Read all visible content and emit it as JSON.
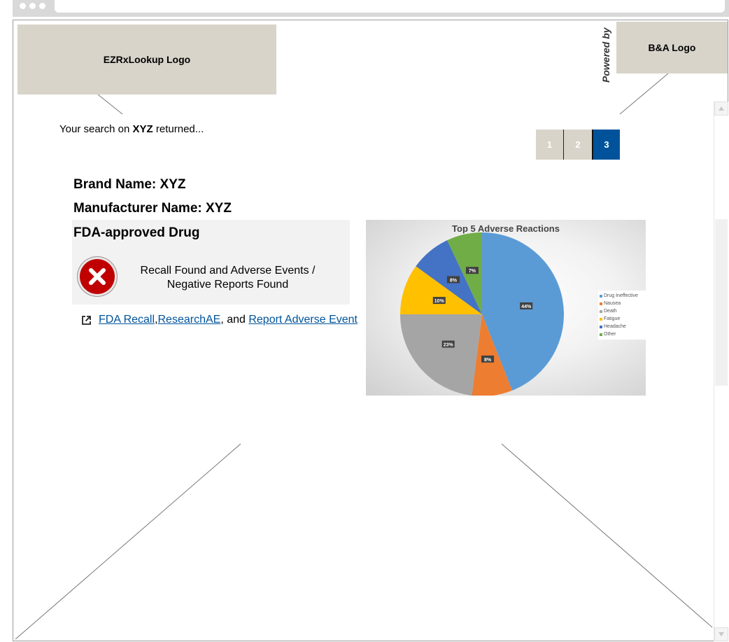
{
  "logos": {
    "ezrx": "EZRxLookup Logo",
    "ba": "B&A Logo",
    "powered_by": "Powered by"
  },
  "search": {
    "prefix": "Your search on ",
    "term": "XYZ",
    "suffix": " returned..."
  },
  "pagination": {
    "pages": [
      "1",
      "2",
      "3"
    ],
    "active": "3"
  },
  "drug": {
    "brand": "Brand Name: XYZ",
    "manufacturer": "Manufacturer Name: XYZ",
    "status_title": "FDA-approved Drug",
    "status_line1": "Recall Found and Adverse Events /",
    "status_line2": "Negative Reports Found",
    "status_icon": "error-x-icon",
    "status_color": "#c00000"
  },
  "links": {
    "icon": "external-link-icon",
    "fda_recall": "FDA Recall",
    "sep1": ", ",
    "research_ae": "ResearchAE",
    "sep2": ", and ",
    "report_event": "Report Adverse Event"
  },
  "chart_data": {
    "type": "pie",
    "title": "Top 5 Adverse Reactions",
    "categories": [
      "Drug Ineffective",
      "Nausea",
      "Death",
      "Fatigue",
      "Headache",
      "Other"
    ],
    "values": [
      44,
      8,
      23,
      10,
      8,
      7
    ],
    "labels": [
      "44%",
      "8%",
      "23%",
      "10%",
      "8%",
      "7%"
    ],
    "colors": [
      "#5b9bd5",
      "#ed7d31",
      "#a5a5a5",
      "#ffc000",
      "#4472c4",
      "#70ad47"
    ],
    "legend": "right"
  },
  "colors": {
    "logo_bg": "#d8d4ca",
    "accent": "#00539b"
  }
}
